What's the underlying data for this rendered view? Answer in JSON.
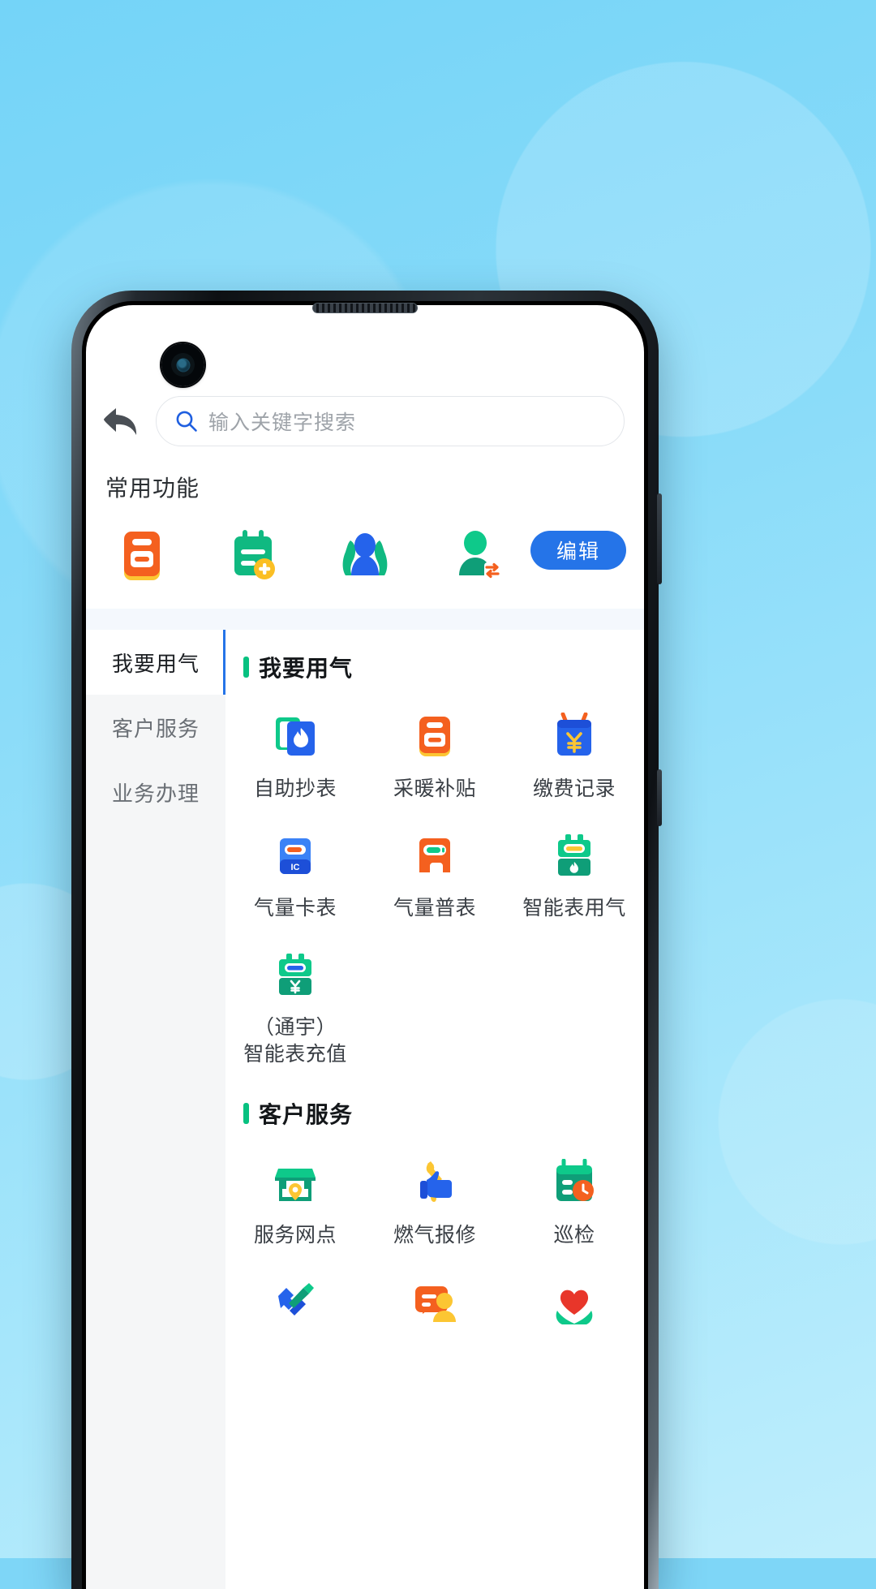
{
  "background": {
    "accent_blue": "#7ed6f7"
  },
  "search": {
    "placeholder": "输入关键字搜索",
    "value": "",
    "back_label": "返回"
  },
  "common": {
    "title": "常用功能",
    "edit_label": "编辑",
    "items": [
      {
        "name": "采暖补贴",
        "icon": "meter-orange-icon"
      },
      {
        "name": "报装申请",
        "icon": "note-add-green-icon"
      },
      {
        "name": "用户群组",
        "icon": "people-blue-icon"
      },
      {
        "name": "过户",
        "icon": "person-transfer-icon"
      }
    ]
  },
  "sidebar": {
    "items": [
      {
        "label": "我要用气",
        "active": true
      },
      {
        "label": "客户服务",
        "active": false
      },
      {
        "label": "业务办理",
        "active": false
      }
    ]
  },
  "sections": [
    {
      "title": "我要用气",
      "items": [
        {
          "label": "自助抄表",
          "icon": "gas-card-flame-icon"
        },
        {
          "label": "采暖补贴",
          "icon": "meter-orange-icon"
        },
        {
          "label": "缴费记录",
          "icon": "calendar-yen-icon"
        },
        {
          "label": "气量卡表",
          "icon": "ic-card-meter-icon"
        },
        {
          "label": "气量普表",
          "icon": "standard-meter-icon"
        },
        {
          "label": "智能表用气",
          "icon": "smart-meter-flame-icon"
        },
        {
          "label": "（通宇）\n智能表充值",
          "icon": "smart-meter-yen-icon"
        }
      ]
    },
    {
      "title": "客户服务",
      "items": [
        {
          "label": "服务网点",
          "icon": "shop-location-icon"
        },
        {
          "label": "燃气报修",
          "icon": "wrench-thumb-icon"
        },
        {
          "label": "巡检",
          "icon": "calendar-clock-icon"
        },
        {
          "label": "",
          "icon": "hammer-screwdriver-icon"
        },
        {
          "label": "",
          "icon": "message-user-icon"
        },
        {
          "label": "",
          "icon": "heart-hands-icon"
        }
      ]
    }
  ],
  "colors": {
    "primary_blue": "#2574e8",
    "green": "#07c180",
    "orange": "#f4601f",
    "yellow": "#fdbe2c"
  }
}
